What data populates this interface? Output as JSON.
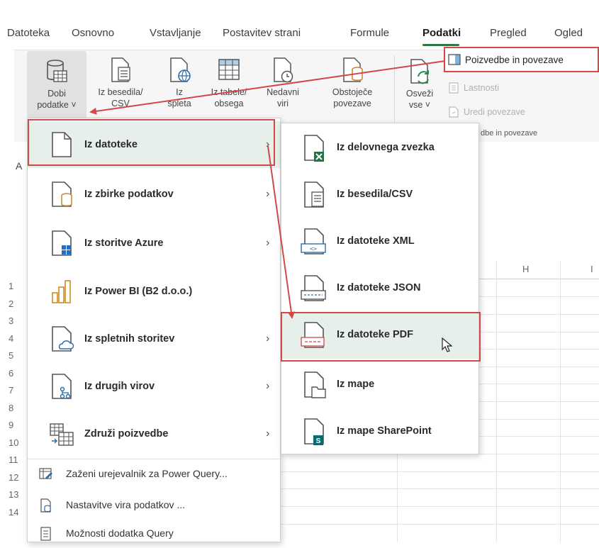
{
  "tabs": [
    {
      "label": "Datoteka"
    },
    {
      "label": "Osnovno"
    },
    {
      "label": "Vstavljanje"
    },
    {
      "label": "Postavitev strani"
    },
    {
      "label": "Formule"
    },
    {
      "label": "Podatki"
    },
    {
      "label": "Pregled"
    },
    {
      "label": "Ogled"
    }
  ],
  "active_tab": "Podatki",
  "ribbon": {
    "get_data": {
      "line1": "Dobi",
      "line2": "podatke ˅"
    },
    "from_text": {
      "line1": "Iz besedila/",
      "line2": "CSV"
    },
    "from_web": {
      "line1": "Iz",
      "line2": "spleta"
    },
    "from_table": {
      "line1": "Iz tabele/",
      "line2": "obsega"
    },
    "recent": {
      "line1": "Nedavni",
      "line2": "viri"
    },
    "existing": {
      "line1": "Obstoječe",
      "line2": "povezave"
    },
    "refresh": {
      "line1": "Osveži",
      "line2": "vse ˅"
    },
    "queries_connections": "Poizvedbe in povezave",
    "properties": "Lastnosti",
    "edit_links": "Uredi povezave",
    "group_label": "dbe in povezave"
  },
  "name_box_letter": "A",
  "columns": [
    "H",
    "I"
  ],
  "rows": [
    "1",
    "2",
    "3",
    "4",
    "5",
    "6",
    "7",
    "8",
    "9",
    "10",
    "11",
    "12",
    "13",
    "14"
  ],
  "menu_main": {
    "items": [
      {
        "label": "Iz datoteke",
        "icon": "file-icon",
        "submenu": true
      },
      {
        "label": "Iz zbirke podatkov",
        "icon": "database-icon",
        "submenu": true
      },
      {
        "label": "Iz storitve Azure",
        "icon": "azure-icon",
        "submenu": true
      },
      {
        "label": "Iz Power BI (B2 d.o.o.)",
        "icon": "power-bi-icon",
        "submenu": false
      },
      {
        "label": "Iz spletnih storitev",
        "icon": "cloud-icon",
        "submenu": true
      },
      {
        "label": "Iz drugih virov",
        "icon": "other-sources-icon",
        "submenu": true
      },
      {
        "label": "Združi poizvedbe",
        "icon": "combine-icon",
        "submenu": true
      }
    ],
    "extra": [
      {
        "label": "Zaženi urejevalnik za Power Query...",
        "icon": "power-query-icon"
      },
      {
        "label": "Nastavitve vira podatkov ...",
        "icon": "data-source-icon"
      },
      {
        "label": "Možnosti dodatka Query",
        "icon": "query-options-icon"
      }
    ]
  },
  "menu_sub": {
    "items": [
      {
        "label": "Iz delovnega zvezka",
        "icon": "excel-workbook-icon"
      },
      {
        "label": "Iz besedila/CSV",
        "icon": "text-csv-icon"
      },
      {
        "label": "Iz datoteke XML",
        "icon": "xml-icon"
      },
      {
        "label": "Iz datoteke JSON",
        "icon": "json-icon"
      },
      {
        "label": "Iz datoteke PDF",
        "icon": "pdf-icon"
      },
      {
        "label": "Iz mape",
        "icon": "folder-icon"
      },
      {
        "label": "Iz mape SharePoint",
        "icon": "sharepoint-icon"
      }
    ]
  },
  "colors": {
    "highlight": "#d04848",
    "excel_green": "#217346",
    "accent_blue": "#2b6cb0"
  }
}
